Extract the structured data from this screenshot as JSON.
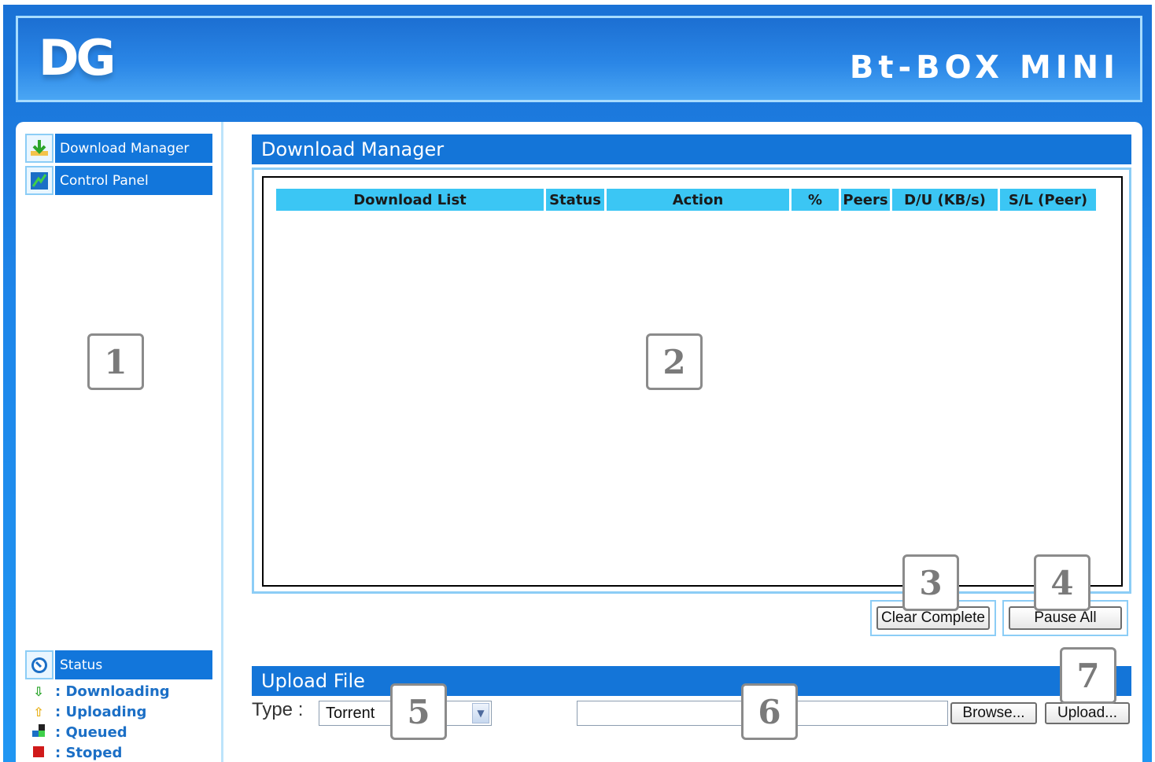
{
  "header": {
    "logo_left": "DG",
    "logo_right": "Bt-BOX MINI"
  },
  "sidebar": {
    "items": [
      {
        "label": "Download Manager",
        "icon": "download-arrow-icon"
      },
      {
        "label": "Control Panel",
        "icon": "control-panel-icon"
      }
    ],
    "status_title": "Status",
    "legend": [
      {
        "label": ": Downloading",
        "icon": "down-arrow-icon",
        "color": "#2aa52a"
      },
      {
        "label": ": Uploading",
        "icon": "up-arrow-icon",
        "color": "#e8b21c"
      },
      {
        "label": ": Queued",
        "icon": "queued-icon",
        "color": "#1b6fc6"
      },
      {
        "label": ": Stoped",
        "icon": "stop-icon",
        "color": "#d01a1a"
      }
    ]
  },
  "download_manager": {
    "title": "Download Manager",
    "columns": [
      "Download List",
      "Status",
      "Action",
      "%",
      "Peers",
      "D/U (KB/s)",
      "S/L (Peer)"
    ],
    "clear_complete_label": "Clear Complete",
    "pause_all_label": "Pause All"
  },
  "upload": {
    "title": "Upload File",
    "type_label": "Type :",
    "type_value": "Torrent",
    "browse_label": "Browse...",
    "upload_label": "Upload..."
  },
  "callouts": [
    "1",
    "2",
    "3",
    "4",
    "5",
    "6",
    "7"
  ],
  "colors": {
    "accent": "#1475d8",
    "header_column": "#3bc6f4",
    "frame": "#1e86ea"
  }
}
